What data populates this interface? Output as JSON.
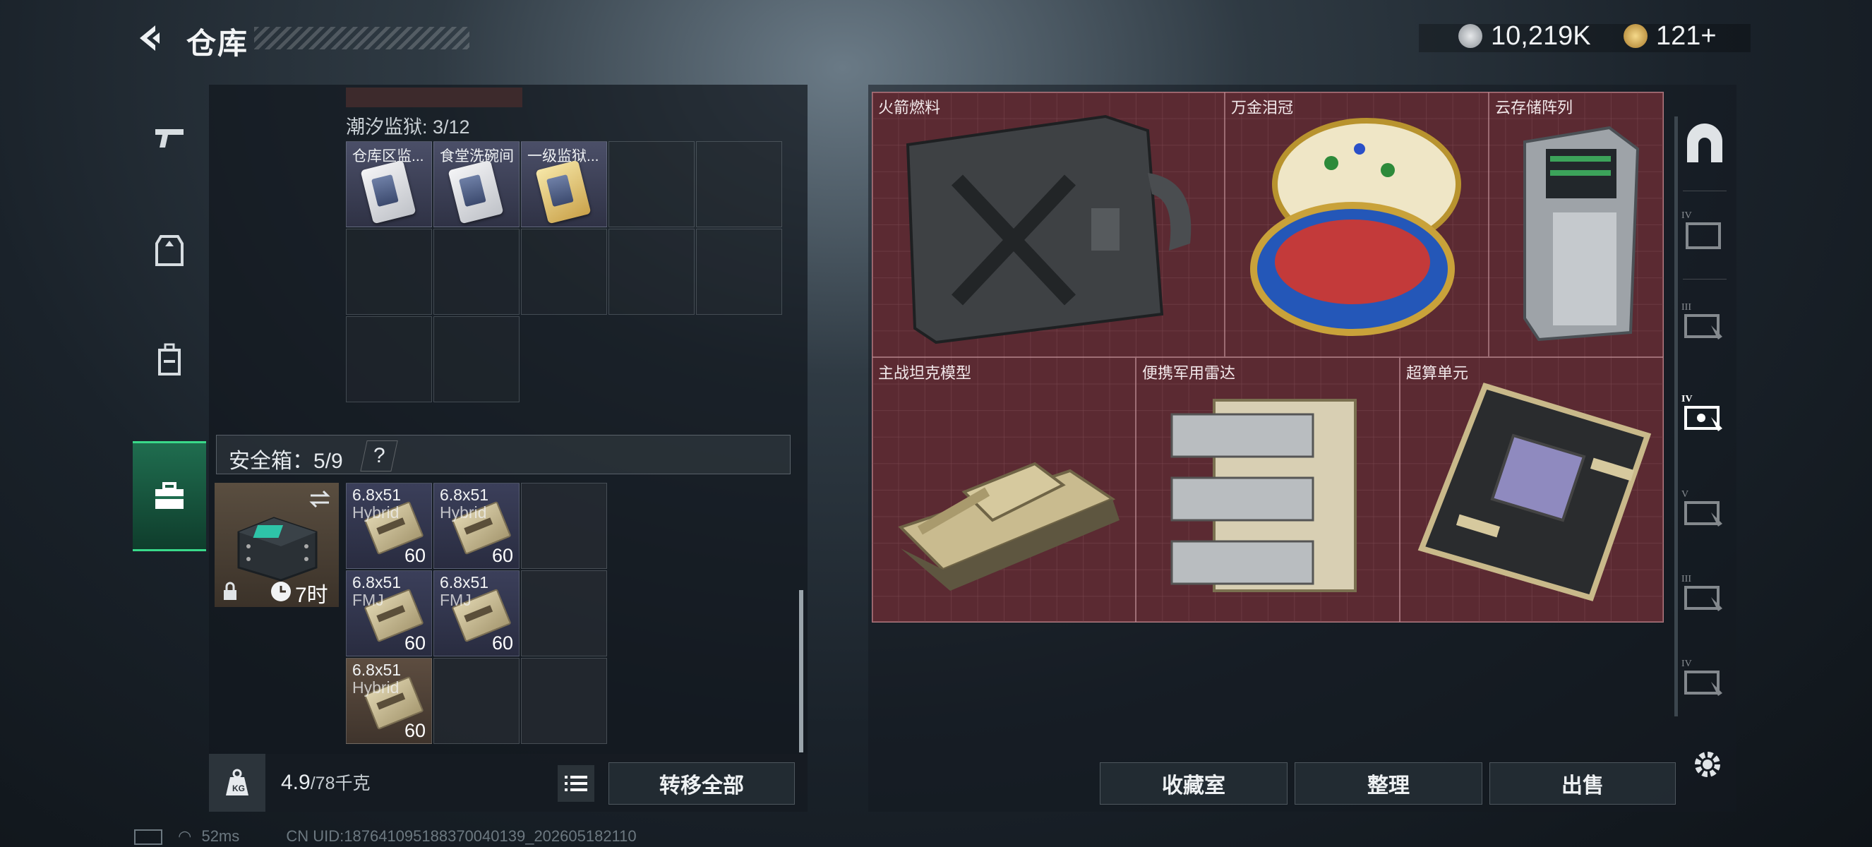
{
  "header": {
    "title": "仓库",
    "currency_primary": "10,219K",
    "currency_secondary": "121+"
  },
  "left_rail": {
    "items": [
      {
        "name": "weapons",
        "icon": "gun-icon"
      },
      {
        "name": "armor",
        "icon": "armor-icon"
      },
      {
        "name": "backpack",
        "icon": "backpack-icon"
      },
      {
        "name": "safe-box",
        "icon": "toolbox-icon",
        "active": true
      }
    ]
  },
  "container": {
    "label": "潮汐监狱: 3/12",
    "items": [
      "仓库区监...",
      "食堂洗碗间",
      "一级监狱..."
    ]
  },
  "safe_box": {
    "title": "安全箱：5/9",
    "help": "?",
    "timer": "7时",
    "ammo": [
      {
        "name": "6.8x51",
        "sub": "Hybrid",
        "count": "60"
      },
      {
        "name": "6.8x51",
        "sub": "Hybrid",
        "count": "60"
      },
      {
        "name": "6.8x51",
        "sub": "FMJ",
        "count": "60"
      },
      {
        "name": "6.8x51",
        "sub": "FMJ",
        "count": "60"
      },
      {
        "name": "6.8x51",
        "sub": "Hybrid",
        "count": "60"
      }
    ]
  },
  "weight": {
    "current": "4.9",
    "max": "/78千克"
  },
  "buttons": {
    "transfer_all": "转移全部",
    "collection": "收藏室",
    "organize": "整理",
    "sell": "出售"
  },
  "stash_items": [
    {
      "name": "火箭燃料"
    },
    {
      "name": "万金泪冠"
    },
    {
      "name": "云存储阵列"
    },
    {
      "name": "主战坦克模型"
    },
    {
      "name": "便携军用雷达"
    },
    {
      "name": "超算单元"
    }
  ],
  "right_sidebar": {
    "items": [
      "tunnel-icon",
      "tier-4-folder-icon",
      "tier-3-card-icon",
      "tier-4-card-icon",
      "tier-5-card-icon",
      "tier-3-card-icon",
      "tier-4-card-icon"
    ]
  },
  "status": {
    "ping": "52ms",
    "uid": "CN UID:187641095188370040139_202605182110"
  },
  "colors": {
    "accent_green": "#39d98a",
    "stash_red": "#5b2a32",
    "item_blue": "#3b3f5a"
  }
}
